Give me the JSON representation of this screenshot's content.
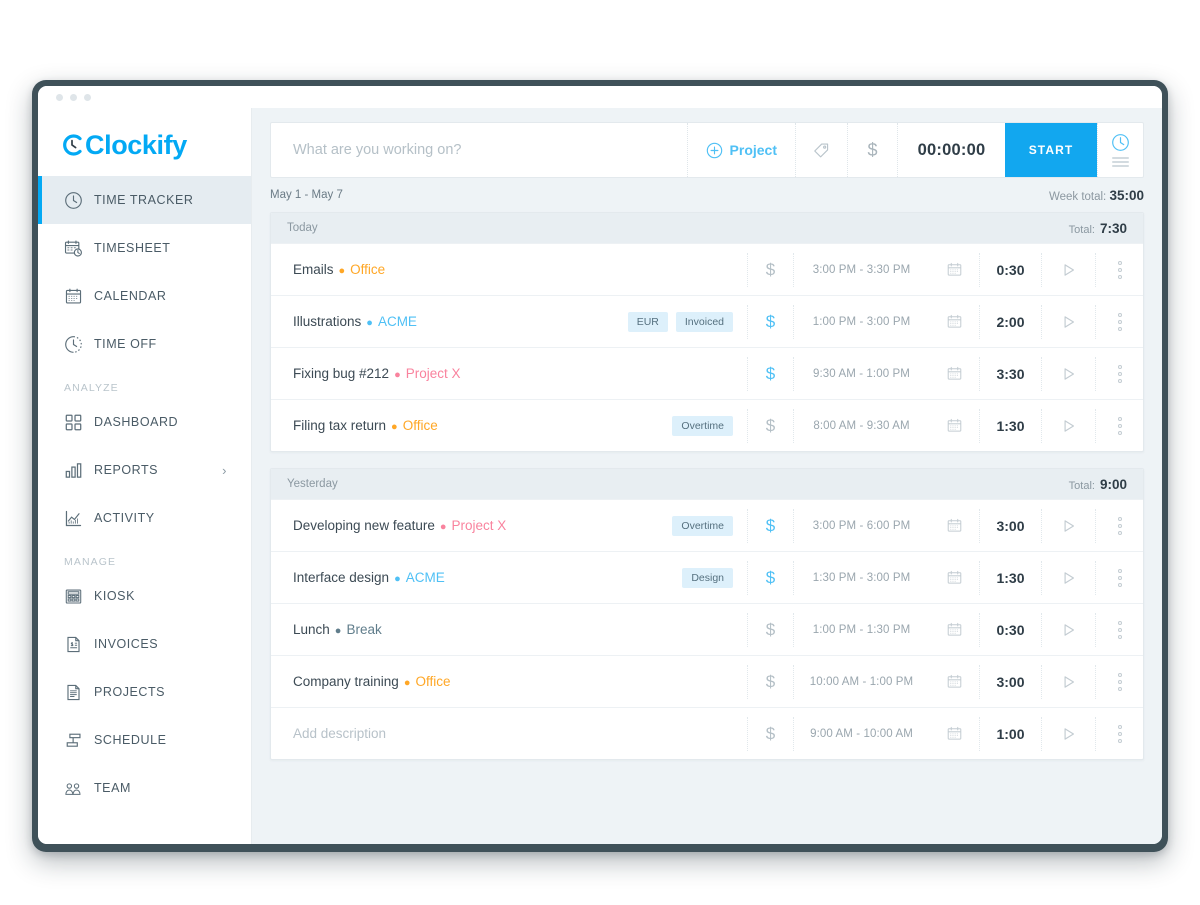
{
  "window": {
    "dots": 3
  },
  "brand": {
    "name": "Clockify",
    "color": "#03a9f4"
  },
  "sidebar": {
    "items": [
      {
        "label": "TIME TRACKER",
        "icon": "clock-icon",
        "active": true
      },
      {
        "label": "TIMESHEET",
        "icon": "timesheet-icon",
        "active": false
      },
      {
        "label": "CALENDAR",
        "icon": "calendar-icon",
        "active": false
      },
      {
        "label": "TIME OFF",
        "icon": "time-off-icon",
        "active": false
      }
    ],
    "sections": [
      {
        "title": "ANALYZE",
        "items": [
          {
            "label": "DASHBOARD",
            "icon": "dashboard-icon",
            "chevron": ""
          },
          {
            "label": "REPORTS",
            "icon": "reports-icon",
            "chevron": "›"
          },
          {
            "label": "ACTIVITY",
            "icon": "activity-icon",
            "chevron": ""
          }
        ]
      },
      {
        "title": "MANAGE",
        "items": [
          {
            "label": "KIOSK",
            "icon": "kiosk-icon",
            "chevron": ""
          },
          {
            "label": "INVOICES",
            "icon": "invoices-icon",
            "chevron": ""
          },
          {
            "label": "PROJECTS",
            "icon": "projects-icon",
            "chevron": ""
          },
          {
            "label": "SCHEDULE",
            "icon": "schedule-icon",
            "chevron": ""
          },
          {
            "label": "TEAM",
            "icon": "team-icon",
            "chevron": ""
          }
        ]
      }
    ]
  },
  "timer": {
    "placeholder": "What are you working on?",
    "value": "",
    "project_label": "Project",
    "tag_icon": "tag-icon",
    "billable_icon": "dollar-icon",
    "elapsed": "00:00:00",
    "start_label": "START",
    "mode_icon": "clock-icon",
    "mode_list_icon": "list-icon"
  },
  "week": {
    "range": "May 1 - May 7",
    "total_label": "Week total:",
    "total_value": "35:00"
  },
  "groups": [
    {
      "title": "Today",
      "total_label": "Total:",
      "total_value": "7:30",
      "entries": [
        {
          "description": "Emails",
          "project": "Office",
          "project_color": "#ffa726",
          "tags": [],
          "billable": false,
          "time_range": "3:00 PM - 3:30 PM",
          "duration": "0:30"
        },
        {
          "description": "Illustrations",
          "project": "ACME",
          "project_color": "#4fc0f5",
          "tags": [
            "EUR",
            "Invoiced"
          ],
          "billable": true,
          "time_range": "1:00 PM - 3:00 PM",
          "duration": "2:00"
        },
        {
          "description": "Fixing bug #212",
          "project": "Project X",
          "project_color": "#f9839e",
          "tags": [],
          "billable": true,
          "time_range": "9:30 AM - 1:00 PM",
          "duration": "3:30"
        },
        {
          "description": "Filing tax return",
          "project": "Office",
          "project_color": "#ffa726",
          "tags": [
            "Overtime"
          ],
          "billable": false,
          "time_range": "8:00 AM - 9:30 AM",
          "duration": "1:30"
        }
      ]
    },
    {
      "title": "Yesterday",
      "total_label": "Total:",
      "total_value": "9:00",
      "entries": [
        {
          "description": "Developing new feature",
          "project": "Project X",
          "project_color": "#f9839e",
          "tags": [
            "Overtime"
          ],
          "billable": true,
          "time_range": "3:00 PM - 6:00 PM",
          "duration": "3:00"
        },
        {
          "description": "Interface design",
          "project": "ACME",
          "project_color": "#4fc0f5",
          "tags": [
            "Design"
          ],
          "billable": true,
          "time_range": "1:30 PM - 3:00 PM",
          "duration": "1:30"
        },
        {
          "description": "Lunch",
          "project": "Break",
          "project_color": "#607d8b",
          "tags": [],
          "billable": false,
          "time_range": "1:00 PM - 1:30 PM",
          "duration": "0:30"
        },
        {
          "description": "Company training",
          "project": "Office",
          "project_color": "#ffa726",
          "tags": [],
          "billable": false,
          "time_range": "10:00 AM - 1:00 PM",
          "duration": "3:00"
        },
        {
          "description": "Add description",
          "empty": true,
          "project": "",
          "project_color": "",
          "tags": [],
          "billable": false,
          "time_range": "9:00 AM - 10:00 AM",
          "duration": "1:00"
        }
      ]
    }
  ]
}
